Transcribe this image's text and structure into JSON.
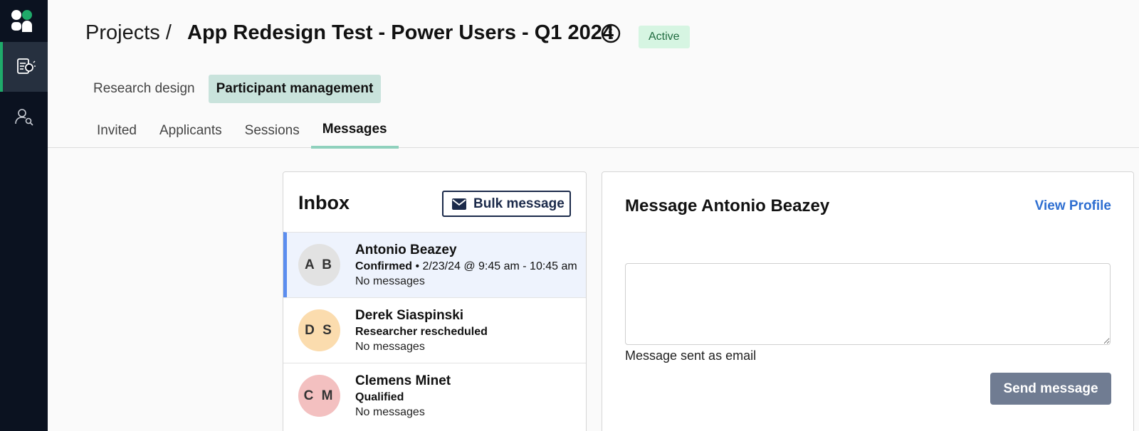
{
  "sidebar": {
    "items": [
      {
        "icon": "research-document-icon",
        "active": true
      },
      {
        "icon": "user-search-icon",
        "active": false
      }
    ]
  },
  "header": {
    "breadcrumb": "Projects /",
    "project_title": "App Redesign Test - Power Users - Q1 2024",
    "status": "Active",
    "view_tabs": [
      {
        "label": "Research design",
        "active": false
      },
      {
        "label": "Participant management",
        "active": true
      }
    ],
    "sub_tabs": [
      {
        "label": "Invited",
        "active": false
      },
      {
        "label": "Applicants",
        "active": false
      },
      {
        "label": "Sessions",
        "active": false
      },
      {
        "label": "Messages",
        "active": true
      }
    ]
  },
  "inbox": {
    "title": "Inbox",
    "bulk_label": "Bulk message",
    "items": [
      {
        "initials": "A B",
        "name": "Antonio Beazey",
        "status": "Confirmed",
        "detail": " • 2/23/24 @ 9:45 am - 10:45 am",
        "meta": "No messages",
        "avatar_color": "#e2e2e2",
        "selected": true
      },
      {
        "initials": "D S",
        "name": "Derek Siaspinski",
        "status": "Researcher rescheduled",
        "detail": "",
        "meta": "No messages",
        "avatar_color": "#fbdcae",
        "selected": false
      },
      {
        "initials": "C M",
        "name": "Clemens Minet",
        "status": "Qualified",
        "detail": "",
        "meta": "No messages",
        "avatar_color": "#f3c0c0",
        "selected": false
      }
    ]
  },
  "compose": {
    "title": "Message Antonio Beazey",
    "view_profile": "View Profile",
    "textarea_value": "",
    "email_note": "Message sent as email",
    "send_label": "Send message"
  },
  "colors": {
    "rail_bg": "#0b1220",
    "accent_green": "#1faa6a",
    "tab_active_bg": "#c9e3dc",
    "link_blue": "#2f6fd1",
    "send_btn": "#707c92"
  }
}
